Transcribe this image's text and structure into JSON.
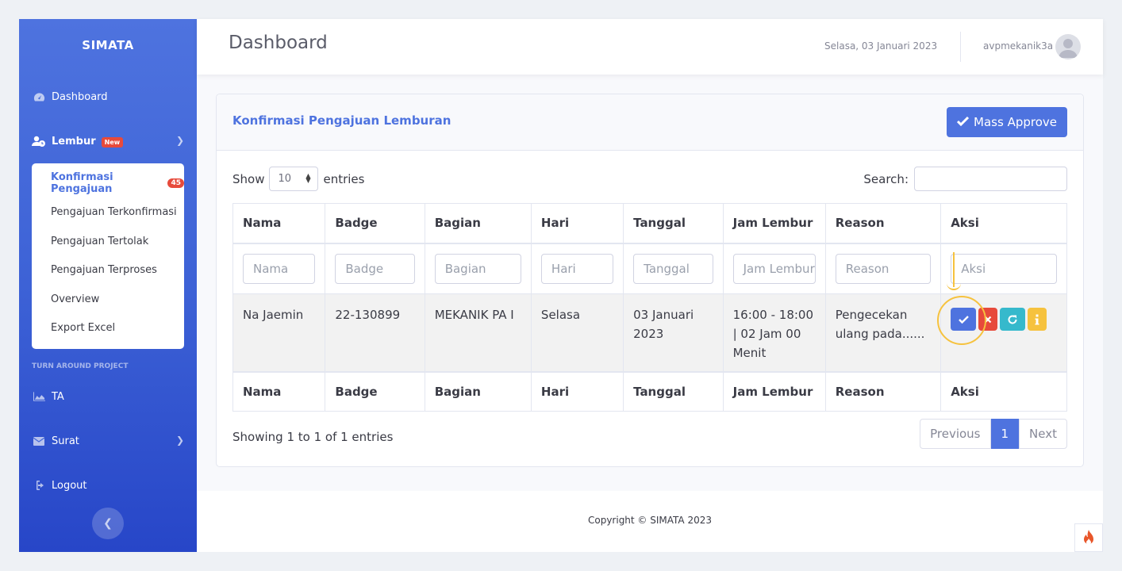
{
  "brand": "SIMATA",
  "sidebar": {
    "dashboard": "Dashboard",
    "lembur": "Lembur",
    "lembur_badge": "New",
    "submenu": [
      {
        "label": "Konfirmasi Pengajuan",
        "count": "45"
      },
      {
        "label": "Pengajuan Terkonfirmasi"
      },
      {
        "label": "Pengajuan Tertolak"
      },
      {
        "label": "Pengajuan Terproses"
      },
      {
        "label": "Overview"
      },
      {
        "label": "Export Excel"
      }
    ],
    "section_heading": "Turn Around Project",
    "ta": "TA",
    "surat": "Surat",
    "logout": "Logout"
  },
  "topbar": {
    "title": "Dashboard",
    "date": "Selasa, 03 Januari 2023",
    "user": "avpmekanik3a"
  },
  "card": {
    "title": "Konfirmasi Pengajuan Lemburan",
    "mass_approve": "Mass Approve",
    "show_label": "Show",
    "entries_value": "10",
    "entries_label": "entries",
    "search_label": "Search:"
  },
  "table": {
    "columns": [
      "Nama",
      "Badge",
      "Bagian",
      "Hari",
      "Tanggal",
      "Jam Lembur",
      "Reason",
      "Aksi"
    ],
    "filters": [
      "Nama",
      "Badge",
      "Bagian",
      "Hari",
      "Tanggal",
      "Jam Lembur",
      "Reason",
      "Aksi"
    ],
    "rows": [
      {
        "nama": "Na Jaemin",
        "badge": "22-130899",
        "bagian": "MEKANIK PA I",
        "hari": "Selasa",
        "tanggal": "03 Januari 2023",
        "jam_lembur": "16:00 - 18:00 | 02 Jam 00 Menit",
        "reason": "Pengecekan ulang pada......"
      }
    ]
  },
  "footer_info": {
    "showing": "Showing 1 to 1 of 1 entries",
    "prev": "Previous",
    "page": "1",
    "next": "Next"
  },
  "copyright": "Copyright © SIMATA 2023",
  "colors": {
    "primary": "#4e73df",
    "danger": "#e74a3b",
    "info": "#36b9cc",
    "warning": "#f6c23e"
  }
}
